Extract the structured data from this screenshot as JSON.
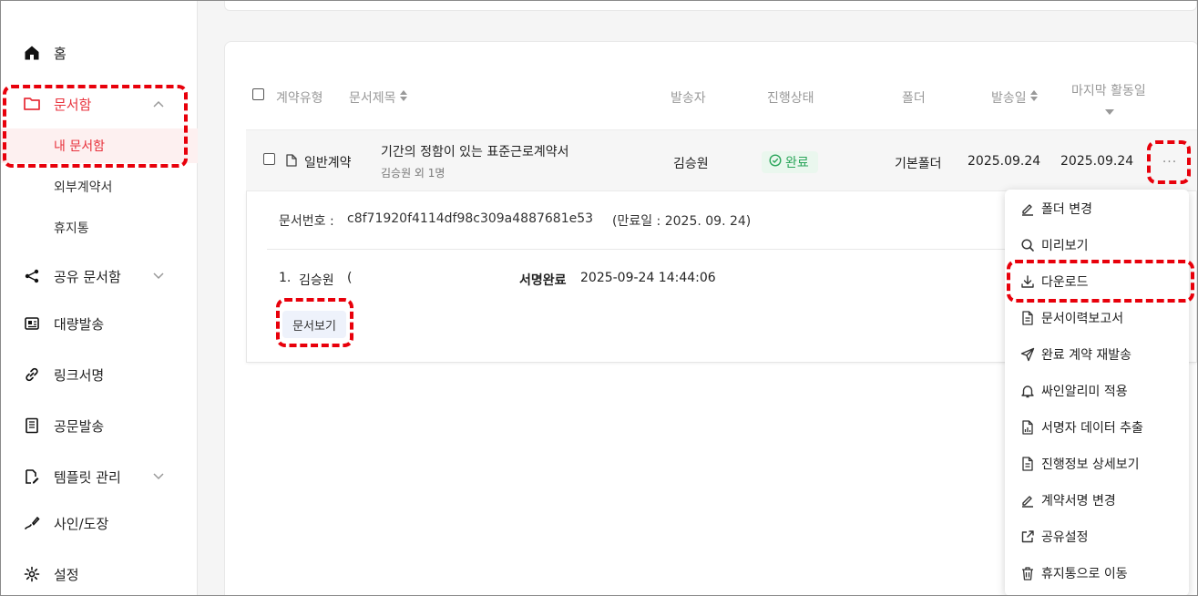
{
  "sidebar": {
    "items": [
      {
        "label": "홈",
        "icon": "home-icon"
      },
      {
        "label": "문서함",
        "icon": "folder-icon"
      },
      {
        "label": "공유 문서함",
        "icon": "share-icon"
      },
      {
        "label": "대량발송",
        "icon": "bulk-send-icon"
      },
      {
        "label": "링크서명",
        "icon": "link-icon"
      },
      {
        "label": "공문발송",
        "icon": "official-doc-icon"
      },
      {
        "label": "템플릿 관리",
        "icon": "template-icon"
      },
      {
        "label": "사인/도장",
        "icon": "signature-icon"
      },
      {
        "label": "설정",
        "icon": "gear-icon"
      }
    ],
    "sub_items": [
      "내 문서함",
      "외부계약서",
      "휴지통"
    ]
  },
  "table": {
    "headers": {
      "contract_type": "계약유형",
      "doc_title": "문서제목",
      "sender": "발송자",
      "status": "진행상태",
      "folder": "폴더",
      "sent_date": "발송일",
      "last_activity": "마지막 활동일"
    },
    "row": {
      "contract_type": "일반계약",
      "title": "기간의 정함이 있는 표준근로계약서",
      "recipients": "김승원 외 1명",
      "sender": "김승원",
      "status": "완료",
      "folder": "기본폴더",
      "sent_date": "2025.09.24",
      "last_activity": "2025.09.24",
      "more": "···"
    }
  },
  "detail": {
    "doc_no_label": "문서번호 :",
    "doc_no": "c8f71920f4114df98c309a4887681e53",
    "expiry": "(만료일 : 2025. 09. 24)",
    "signer_index": "1.",
    "signer_name": "김승원",
    "signer_paren": "(",
    "sign_status": "서명완료",
    "sign_time": "2025-09-24 14:44:06",
    "view_button": "문서보기"
  },
  "menu": {
    "items": [
      {
        "label": "폴더 변경",
        "icon": "pencil-icon"
      },
      {
        "label": "미리보기",
        "icon": "search-icon"
      },
      {
        "label": "다운로드",
        "icon": "download-icon"
      },
      {
        "label": "문서이력보고서",
        "icon": "document-icon"
      },
      {
        "label": "완료 계약 재발송",
        "icon": "send-icon"
      },
      {
        "label": "싸인알리미 적용",
        "icon": "bell-icon"
      },
      {
        "label": "서명자 데이터 추출",
        "icon": "data-export-icon"
      },
      {
        "label": "진행정보 상세보기",
        "icon": "document-detail-icon"
      },
      {
        "label": "계약서명 변경",
        "icon": "pencil-icon"
      },
      {
        "label": "공유설정",
        "icon": "external-link-icon"
      },
      {
        "label": "휴지통으로 이동",
        "icon": "trash-icon"
      }
    ]
  },
  "colors": {
    "accent": "#e8323c",
    "success": "#2aa55a",
    "highlight": "#e8000b"
  }
}
